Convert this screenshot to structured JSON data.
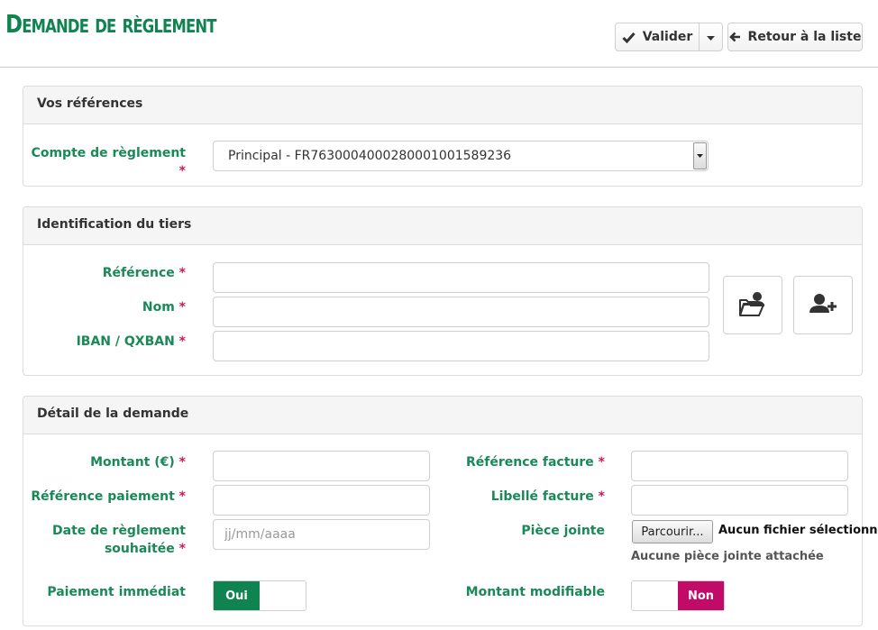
{
  "header": {
    "title": "Demande de règlement",
    "validate_label": "Valider",
    "back_label": "Retour à la liste"
  },
  "references": {
    "title": "Vos références",
    "account_label": "Compte de règlement",
    "account_value": "Principal - FR7630004000280001001589236"
  },
  "third_party": {
    "title": "Identification du tiers",
    "reference_label": "Référence",
    "name_label": "Nom",
    "iban_label": "IBAN / QXBAN"
  },
  "details": {
    "title": "Détail de la demande",
    "amount_label": "Montant (€)",
    "payment_ref_label": "Référence paiement",
    "date_label_line1": "Date de règlement",
    "date_label_line2": "souhaitée",
    "date_placeholder": "jj/mm/aaaa",
    "immediate_label": "Paiement immédiat",
    "immediate_value": "Oui",
    "invoice_ref_label": "Référence facture",
    "invoice_label_label": "Libellé facture",
    "attachment_label": "Pièce jointe",
    "browse_label": "Parcourir...",
    "no_file_label": "Aucun fichier sélectionné.",
    "no_attachment_label": "Aucune pièce jointe attachée",
    "editable_amount_label": "Montant modifiable",
    "editable_amount_value": "Non"
  },
  "required_mark": "*",
  "colors": {
    "brand_green": "#0f8450",
    "label_green": "#198a57",
    "required": "#c41e5c",
    "toggle_off": "#c20a68"
  },
  "icons": [
    "check-icon",
    "caret-down-icon",
    "arrow-left-icon",
    "folder-user-icon",
    "add-user-icon"
  ]
}
